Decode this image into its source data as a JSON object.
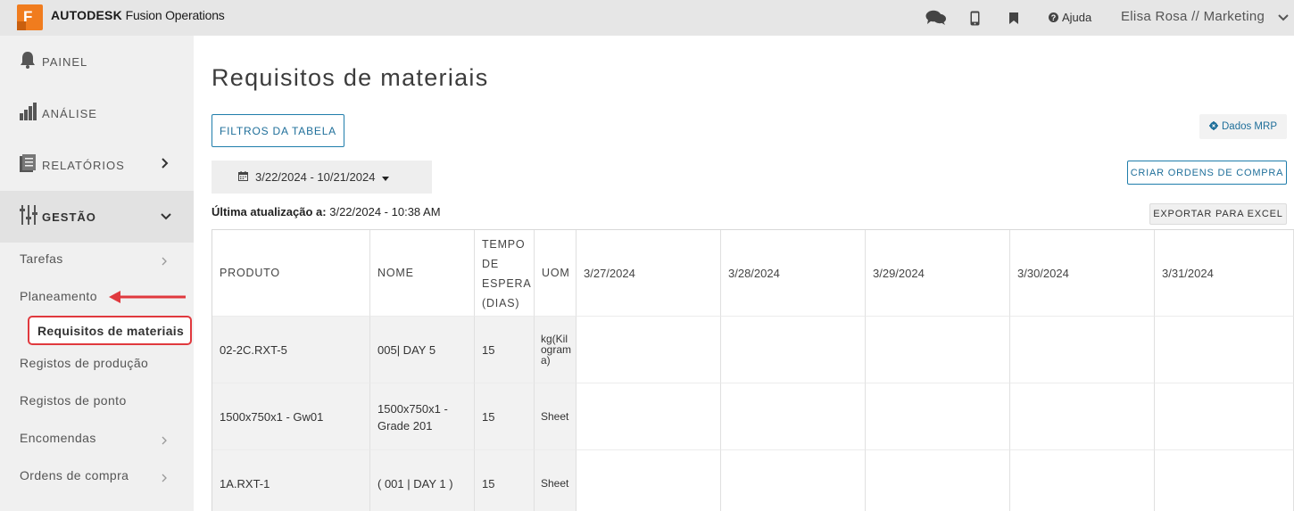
{
  "header": {
    "logo_letter": "F",
    "brand_bold": "AUTODESK",
    "brand_rest": "Fusion Operations",
    "help_label": "Ajuda",
    "user_label": "Elisa Rosa // Marketing",
    "icons": [
      "chat-icon",
      "mobile-icon",
      "bookmark-icon",
      "help-icon",
      "chevron-down-icon"
    ]
  },
  "sidebar": {
    "main_items": [
      {
        "label": "PAINEL",
        "icon": "bell-icon"
      },
      {
        "label": "ANÁLISE",
        "icon": "bar-chart-icon"
      },
      {
        "label": "RELATÓRIOS",
        "icon": "reports-icon"
      },
      {
        "label": "GESTÃO",
        "icon": "sliders-icon"
      }
    ],
    "sub_items": [
      {
        "label": "Tarefas"
      },
      {
        "label": "Planeamento"
      },
      {
        "label": "Requisitos de materiais"
      },
      {
        "label": "Registos de produção"
      },
      {
        "label": "Registos de ponto"
      },
      {
        "label": "Encomendas"
      },
      {
        "label": "Ordens de compra"
      }
    ],
    "annotation_color": "#e0393e"
  },
  "main": {
    "title": "Requisitos de materiais",
    "filters_button": "FILTROS DA TABELA",
    "mrp_button": "Dados MRP",
    "date_range": "3/22/2024 - 10/21/2024",
    "create_po_button": "CRIAR ORDENS DE COMPRA",
    "last_update_label": "Última atualização a:",
    "last_update_value": "3/22/2024 - 10:38 AM",
    "export_button": "EXPORTAR PARA EXCEL"
  },
  "table": {
    "headers": [
      "PRODUTO",
      "NOME",
      "TEMPO DE ESPERA (DIAS)",
      "UOM",
      "3/27/2024",
      "3/28/2024",
      "3/29/2024",
      "3/30/2024",
      "3/31/2024"
    ],
    "rows": [
      {
        "produto": "02-2C.RXT-5",
        "nome": "005| DAY 5",
        "tempo": "15",
        "uom": "kg(Kilograma)"
      },
      {
        "produto": "1500x750x1 - Gw01",
        "nome": "1500x750x1 - Grade 201",
        "tempo": "15",
        "uom": "Sheet"
      },
      {
        "produto": "1A.RXT-1",
        "nome": "( 001 | DAY 1 )",
        "tempo": "15",
        "uom": "Sheet"
      }
    ]
  },
  "colors": {
    "accent": "#1f7dab",
    "logo": "#f07c1e",
    "topbar": "#e6e6e6",
    "sidebar": "#f0f0f0"
  }
}
